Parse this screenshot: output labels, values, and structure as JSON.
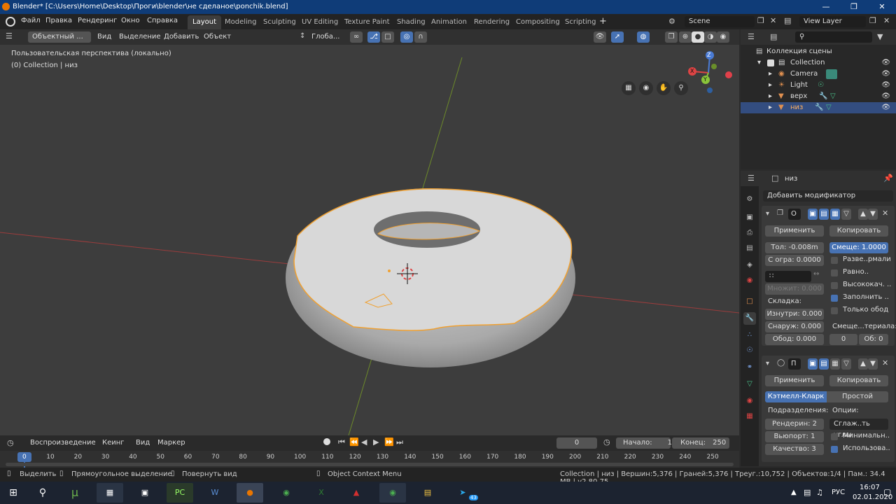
{
  "title": "Blender* [C:\\Users\\Home\\Desktop\\Проги\\blender\\не сделаное\\ponchik.blend]",
  "menu": [
    "Файл",
    "Правка",
    "Рендеринг",
    "Окно",
    "Справка"
  ],
  "workspaces": [
    "Layout",
    "Modeling",
    "Sculpting",
    "UV Editing",
    "Texture Paint",
    "Shading",
    "Animation",
    "Rendering",
    "Compositing",
    "Scripting"
  ],
  "scene": "Scene",
  "view_layer": "View Layer",
  "viewport": {
    "mode": "Объектный ...",
    "menus": [
      "Вид",
      "Выделение",
      "Добавить",
      "Объект"
    ],
    "transform": "Глоба...",
    "info1": "Пользовательская перспектива (локально)",
    "info2": "(0) Collection | низ",
    "axes": {
      "x": "X",
      "y": "Y",
      "z": "Z"
    }
  },
  "outliner": {
    "root": "Коллекция сцены",
    "items": [
      {
        "name": "Collection"
      },
      {
        "name": "Camera"
      },
      {
        "name": "Light"
      },
      {
        "name": "верх"
      },
      {
        "name": "низ"
      }
    ]
  },
  "properties": {
    "object": "низ",
    "add_modifier": "Добавить модификатор",
    "mod1": {
      "name": "О",
      "apply": "Применить",
      "copy": "Копировать",
      "thickness": "Тол: -0.008m",
      "offset": "Смеще: 1.0000",
      "clamp": "С огра: 0.0000",
      "flip": "Разве..рмали",
      "even": "Равно..",
      "high_quality": "Высококач. ..",
      "fill": "Заполнить ..",
      "rim_only": "Только обод",
      "factor": "Множит: 0.000",
      "crease": "Складка:",
      "inner": "Изнутри: 0.000",
      "outer": "Снаруж: 0.000",
      "rim": "Обод: 0.000",
      "mat_offset": "Смеще...териала:",
      "mat_val1": "0",
      "mat_val2": "Об: 0"
    },
    "mod2": {
      "name": "П",
      "apply": "Применить",
      "copy": "Копировать",
      "catmull": "Кэтмелл-Кларк",
      "simple": "Простой",
      "subdiv": "Подразделения:",
      "options": "Опции:",
      "render": "Рендерин: 2",
      "viewport": "Вьюпорт: 1",
      "quality": "Качество: 3",
      "smooth": "Сглаж..ть углы",
      "minimal": "Минимальн..",
      "use": "Использова.."
    }
  },
  "timeline": {
    "playback": "Воспроизведение",
    "keying": "Кеинг",
    "view": "Вид",
    "marker": "Маркер",
    "current": "0",
    "start_label": "Начало:",
    "start": "1",
    "end_label": "Конец:",
    "end": "250",
    "ticks": [
      "0",
      "10",
      "20",
      "30",
      "40",
      "50",
      "60",
      "70",
      "80",
      "90",
      "100",
      "110",
      "120",
      "130",
      "140",
      "150",
      "160",
      "170",
      "180",
      "190",
      "200",
      "210",
      "220",
      "230",
      "240",
      "250"
    ]
  },
  "status": {
    "select": "Выделить",
    "box": "Прямоугольное выделение",
    "rotate": "Повернуть вид",
    "context": "Object Context Menu",
    "stats": "Collection | низ | Вершин:5,376 | Граней:5,376 | Треуг.:10,752 | Объектов:1/4 | Пам.: 34.4 MB | v2.80.75"
  },
  "taskbar": {
    "lang": "РУС",
    "time": "16:07",
    "date": "02.01.2020",
    "telegram_badge": "43"
  },
  "colors": {
    "accent": "#4772b3",
    "selection_outline": "#f0a030",
    "title_bg": "#0f3c78"
  }
}
